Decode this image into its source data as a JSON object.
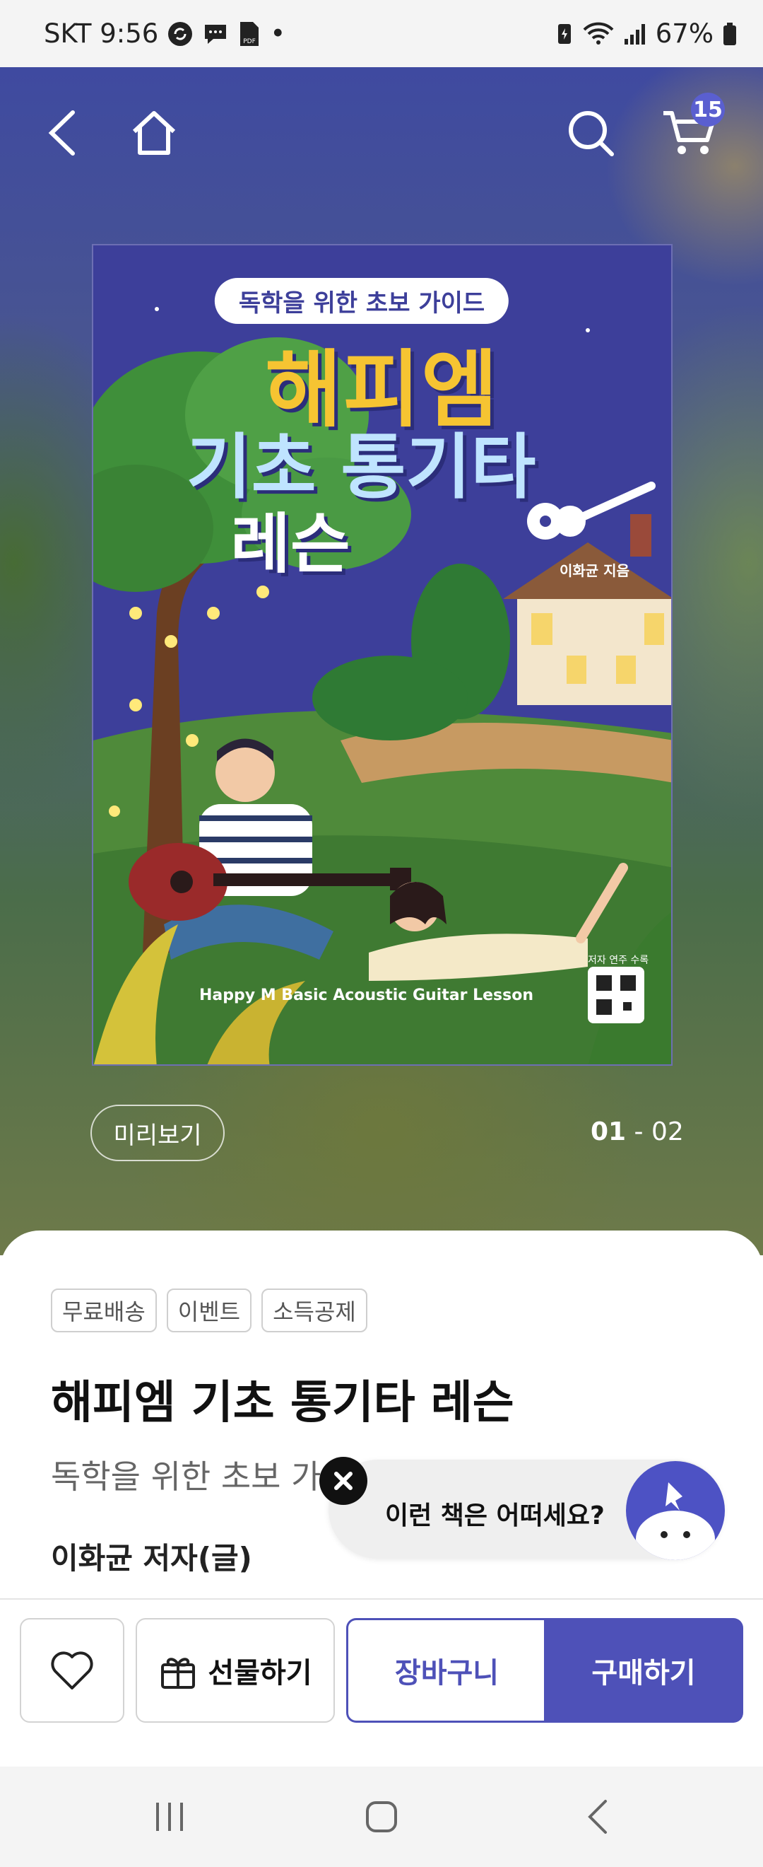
{
  "status_bar": {
    "carrier_time": "SKT 9:56",
    "pdf_label": "PDF",
    "dot": "•",
    "battery": "67%"
  },
  "nav": {
    "cart_count": "15"
  },
  "cover": {
    "badge": "독학을 위한 초보 가이드",
    "title_line1": "해피엠",
    "title_line2": "기초 통기타",
    "title_line3": "레슨",
    "author": "이화균 지음",
    "english_title": "Happy M Basic Acoustic Guitar Lesson",
    "qr_label": "저자 연주 수록"
  },
  "preview": {
    "label": "미리보기",
    "page_current": "01",
    "page_sep": " - ",
    "page_total": "02"
  },
  "product": {
    "tags": [
      "무료배송",
      "이벤트",
      "소득공제"
    ],
    "title": "해피엠 기초 통기타 레슨",
    "subtitle": "독학을 위한 초보 가",
    "author": "이화균 저자(글)"
  },
  "recommendation": {
    "text": "이런 책은 어떠세요?"
  },
  "actions": {
    "gift": "선물하기",
    "cart": "장바구니",
    "buy": "구매하기"
  },
  "colors": {
    "accent": "#4e51b8",
    "badge": "#5a5fd0"
  }
}
